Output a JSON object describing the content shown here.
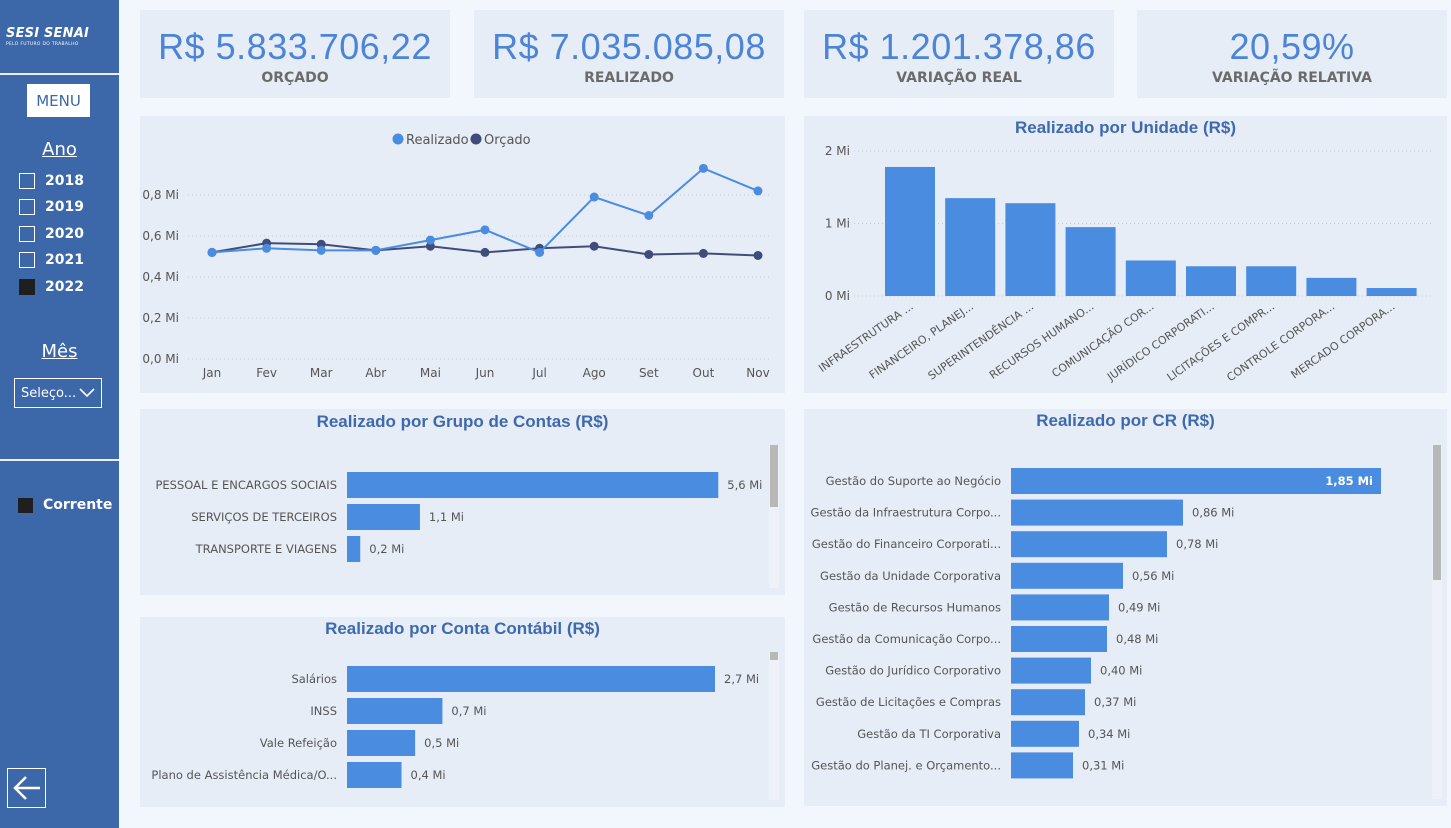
{
  "sidebar": {
    "logo_main": "SESI SENAI",
    "logo_sub": "PELO FUTURO DO TRABALHO",
    "menu_label": "MENU",
    "year_heading": "Ano",
    "years": [
      {
        "label": "2018",
        "checked": false
      },
      {
        "label": "2019",
        "checked": false
      },
      {
        "label": "2020",
        "checked": false
      },
      {
        "label": "2021",
        "checked": false
      },
      {
        "label": "2022",
        "checked": true
      }
    ],
    "month_heading": "Mês",
    "month_select_value": "Seleço...",
    "legend_label": "Corrente",
    "back_icon": "arrow-left-icon"
  },
  "kpis": [
    {
      "value": "R$ 5.833.706,22",
      "label": "ORÇADO"
    },
    {
      "value": "R$ 7.035.085,08",
      "label": "REALIZADO"
    },
    {
      "value": "R$ 1.201.378,86",
      "label": "VARIAÇÃO REAL"
    },
    {
      "value": "20,59%",
      "label": "VARIAÇÃO RELATIVA"
    }
  ],
  "colors": {
    "realizado": "#4a8ce0",
    "orcado": "#404d7a",
    "bar": "#4a8ce0",
    "sidebar": "#3c67a8"
  },
  "chart_data": [
    {
      "type": "line",
      "title": "",
      "legend": [
        "Realizado",
        "Orçado"
      ],
      "categories": [
        "Jan",
        "Fev",
        "Mar",
        "Abr",
        "Mai",
        "Jun",
        "Jul",
        "Ago",
        "Set",
        "Out",
        "Nov"
      ],
      "yticks": [
        "0,0 Mi",
        "0,2 Mi",
        "0,4 Mi",
        "0,6 Mi",
        "0,8 Mi"
      ],
      "ylim": [
        0,
        1.0
      ],
      "series": [
        {
          "name": "Realizado",
          "values": [
            0.52,
            0.54,
            0.53,
            0.53,
            0.58,
            0.63,
            0.52,
            0.79,
            0.7,
            0.93,
            0.82
          ]
        },
        {
          "name": "Orçado",
          "values": [
            0.52,
            0.565,
            0.56,
            0.53,
            0.55,
            0.52,
            0.54,
            0.55,
            0.51,
            0.515,
            0.505
          ]
        }
      ]
    },
    {
      "type": "bar",
      "title": "Realizado por Unidade (R$)",
      "categories": [
        "INFRAESTRUTURA ...",
        "FINANCEIRO, PLANEJ...",
        "SUPERINTENDÊNCIA ...",
        "RECURSOS HUMANO...",
        "COMUNICAÇÃO COR...",
        "JURÍDICO CORPORATI...",
        "LICITAÇÕES E COMPR...",
        "CONTROLE CORPORA...",
        "MERCADO CORPORA..."
      ],
      "values": [
        1.78,
        1.35,
        1.28,
        0.95,
        0.49,
        0.41,
        0.41,
        0.25,
        0.11
      ],
      "yticks": [
        "0 Mi",
        "1 Mi",
        "2 Mi"
      ],
      "ylim": [
        0,
        2
      ]
    },
    {
      "type": "bar",
      "orientation": "horizontal",
      "title": "Realizado por Grupo de Contas (R$)",
      "categories": [
        "PESSOAL E ENCARGOS SOCIAIS",
        "SERVIÇOS DE TERCEIROS",
        "TRANSPORTE E VIAGENS"
      ],
      "values": [
        5.6,
        1.1,
        0.2
      ],
      "labels": [
        "5,6 Mi",
        "1,1 Mi",
        "0,2 Mi"
      ]
    },
    {
      "type": "bar",
      "orientation": "horizontal",
      "title": "Realizado por Conta Contábil (R$)",
      "categories": [
        "Salários",
        "INSS",
        "Vale Refeição",
        "Plano de Assistência Médica/O..."
      ],
      "values": [
        2.7,
        0.7,
        0.5,
        0.4
      ],
      "labels": [
        "2,7 Mi",
        "0,7 Mi",
        "0,5 Mi",
        "0,4 Mi"
      ]
    },
    {
      "type": "bar",
      "orientation": "horizontal",
      "title": "Realizado por CR (R$)",
      "categories": [
        "Gestão do Suporte ao Negócio",
        "Gestão da Infraestrutura Corpo...",
        "Gestão do Financeiro Corporati...",
        "Gestão da Unidade Corporativa",
        "Gestão de Recursos Humanos",
        "Gestão da Comunicação Corpo...",
        "Gestão do Jurídico Corporativo",
        "Gestão de Licitações e Compras",
        "Gestão da TI Corporativa",
        "Gestão do Planej. e Orçamento..."
      ],
      "values": [
        1.85,
        0.86,
        0.78,
        0.56,
        0.49,
        0.48,
        0.4,
        0.37,
        0.34,
        0.31
      ],
      "labels": [
        "1,85 Mi",
        "0,86 Mi",
        "0,78 Mi",
        "0,56 Mi",
        "0,49 Mi",
        "0,48 Mi",
        "0,40 Mi",
        "0,37 Mi",
        "0,34 Mi",
        "0,31 Mi"
      ]
    }
  ]
}
